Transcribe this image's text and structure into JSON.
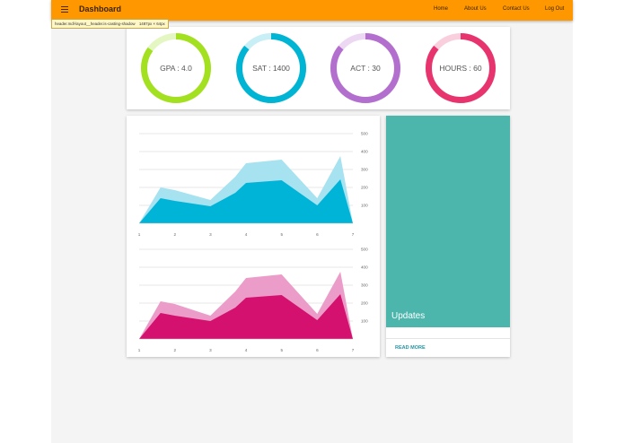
{
  "header": {
    "title": "Dashboard",
    "nav": [
      "Home",
      "About Us",
      "Contact Us",
      "Log Out"
    ],
    "background": "#ff9800"
  },
  "tooltip": {
    "selector": "header.mdl-layout__header.is-casting-shadow",
    "size": "1487px × 64px"
  },
  "gauges": [
    {
      "label": "GPA : 4.0",
      "value": 0.85,
      "color": "#a3e020",
      "track": "#e4f6c2"
    },
    {
      "label": "SAT : 1400",
      "value": 0.86,
      "color": "#00b4d4",
      "track": "#c8eef6"
    },
    {
      "label": "ACT : 30",
      "value": 0.86,
      "color": "#b36fce",
      "track": "#edd8f4"
    },
    {
      "label": "HOURS : 60",
      "value": 0.86,
      "color": "#e8346e",
      "track": "#f9cfdd"
    }
  ],
  "chart_data": [
    {
      "type": "area",
      "x": [
        1,
        1.6,
        2,
        3,
        3.7,
        4,
        5,
        6,
        6.65,
        7
      ],
      "ylim": [
        0,
        500
      ],
      "yticks": [
        100,
        200,
        300,
        400,
        500
      ],
      "xticks": [
        1,
        2,
        3,
        4,
        5,
        6,
        7
      ],
      "grid": true,
      "series": [
        {
          "values": [
            0,
            200,
            185,
            130,
            260,
            335,
            355,
            140,
            375,
            0
          ],
          "color": "#a6e2f0"
        },
        {
          "values": [
            0,
            140,
            125,
            95,
            170,
            225,
            240,
            100,
            245,
            0
          ],
          "color": "#00b4d8"
        }
      ]
    },
    {
      "type": "area",
      "x": [
        1,
        1.6,
        2,
        3,
        3.7,
        4,
        5,
        6,
        6.65,
        7
      ],
      "ylim": [
        0,
        500
      ],
      "yticks": [
        100,
        200,
        300,
        400,
        500
      ],
      "xticks": [
        1,
        2,
        3,
        4,
        5,
        6,
        7
      ],
      "grid": true,
      "series": [
        {
          "values": [
            0,
            210,
            195,
            130,
            265,
            340,
            360,
            140,
            375,
            0
          ],
          "color": "#ec9cc8"
        },
        {
          "values": [
            0,
            145,
            130,
            100,
            175,
            230,
            245,
            105,
            250,
            0
          ],
          "color": "#d4116e"
        }
      ]
    }
  ],
  "updates": {
    "title": "Updates",
    "action": "READ MORE",
    "color": "#4db6ac"
  }
}
